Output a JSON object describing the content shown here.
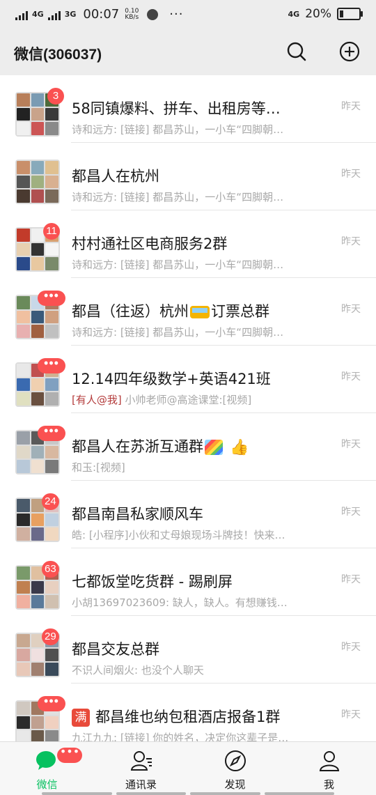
{
  "status_bar": {
    "net1": "4G",
    "net2": "3G",
    "time": "00:07",
    "speed_value": "0.10",
    "speed_unit": "KB/s",
    "more": "···",
    "net_right": "4G",
    "battery_text": "20%",
    "battery_level": 0.2
  },
  "header": {
    "title": "微信(306037)"
  },
  "chats": [
    {
      "name": "58同镇爆料、拼车、出租房等…",
      "preview": "诗和远方: [链接] 都昌苏山，一小车“四脚朝…",
      "time": "昨天",
      "badge": "3"
    },
    {
      "name": "都昌人在杭州",
      "preview": "诗和远方: [链接] 都昌苏山，一小车“四脚朝…",
      "time": "昨天",
      "badge": ""
    },
    {
      "name": "村村通社区电商服务2群",
      "preview": "诗和远方: [链接] 都昌苏山，一小车“四脚朝…",
      "time": "昨天",
      "badge": "11"
    },
    {
      "name_a": "都昌（往返）杭州",
      "name_b": "订票总群",
      "preview": "诗和远方: [链接] 都昌苏山，一小车“四脚朝…",
      "time": "昨天",
      "badge": "•••"
    },
    {
      "name": "12.14四年级数学+英语421班",
      "mention": "[有人@我]",
      "preview": " 小帅老师@高途课堂:[视频]",
      "time": "昨天",
      "badge": "•••"
    },
    {
      "name": "都昌人在苏浙互通群",
      "thumb": "👍",
      "preview": "和玉:[视频]",
      "time": "昨天",
      "badge": "•••"
    },
    {
      "name": "都昌南昌私家顺风车",
      "preview": "皓: [小程序]小伙和丈母娘现场斗牌技！快来…",
      "time": "昨天",
      "badge": "24"
    },
    {
      "name": "七都饭堂吃货群 - 踢刷屏",
      "preview": "小胡13697023609: 缺人，缺人。有想赚钱…",
      "time": "昨天",
      "badge": "63"
    },
    {
      "name": "都昌交友总群",
      "preview": "不识人间烟火: 也没个人聊天",
      "time": "昨天",
      "badge": "29"
    },
    {
      "name_icon": "满",
      "name": "都昌维也纳包租酒店报备1群",
      "preview": "九江九九: [链接] 你的姓名，决定你这辈子是…",
      "time": "昨天",
      "badge": "•••"
    }
  ],
  "tabs": [
    {
      "label": "微信",
      "badge": "•••"
    },
    {
      "label": "通讯录"
    },
    {
      "label": "发现"
    },
    {
      "label": "我"
    }
  ],
  "colors": {
    "accent": "#07c160",
    "badge": "#fa5151",
    "header_bg": "#ededed"
  }
}
